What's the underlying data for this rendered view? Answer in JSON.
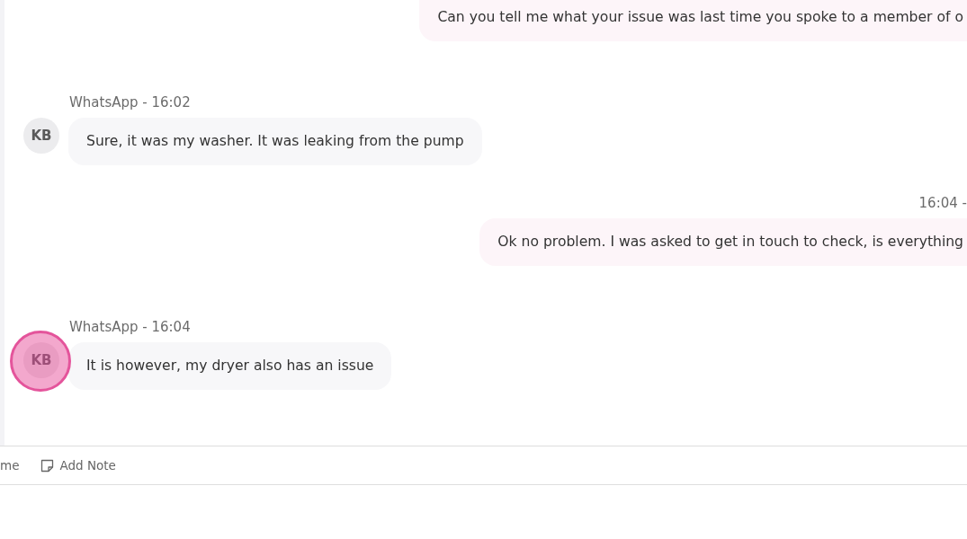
{
  "messages": [
    {
      "kind": "outgoing",
      "text": "Can you tell me what your issue was last time you spoke to a member of o"
    },
    {
      "kind": "incoming",
      "meta": "WhatsApp - 16:02",
      "avatar": "KB",
      "highlighted": false,
      "text": "Sure, it was my washer. It was leaking from the pump"
    },
    {
      "kind": "outgoing",
      "meta": "16:04 -",
      "text": "Ok no problem. I was asked to get in touch to check, is everything"
    },
    {
      "kind": "incoming",
      "meta": "WhatsApp - 16:04",
      "avatar": "KB",
      "highlighted": true,
      "text": "It is however, my dryer also has an issue"
    }
  ],
  "toolbar": {
    "actions": [
      {
        "kind": "plain",
        "label": "me"
      },
      {
        "kind": "note",
        "label": "Add Note"
      }
    ]
  }
}
